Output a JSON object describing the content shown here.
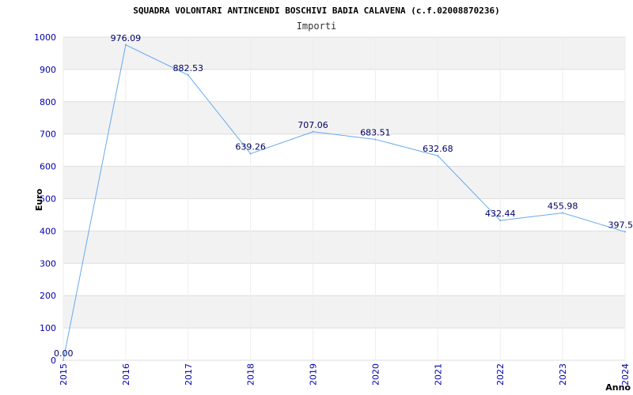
{
  "chart_data": {
    "type": "line",
    "title": "SQUADRA VOLONTARI ANTINCENDI BOSCHIVI BADIA CALAVENA (c.f.02008870236)",
    "subtitle": "Importi",
    "xlabel": "Anno",
    "ylabel": "Euro",
    "ylim": [
      0,
      1000
    ],
    "y_ticks": [
      "0",
      "100",
      "200",
      "300",
      "400",
      "500",
      "600",
      "700",
      "800",
      "900",
      "1000"
    ],
    "x": [
      "2015",
      "2016",
      "2017",
      "2018",
      "2019",
      "2020",
      "2021",
      "2022",
      "2023",
      "2024"
    ],
    "values": [
      0,
      976.09,
      882.53,
      639.26,
      707.06,
      683.51,
      632.68,
      432.44,
      455.98,
      397.5
    ],
    "data_labels": [
      "0.00",
      "976.09",
      "882.53",
      "639.26",
      "707.06",
      "683.51",
      "632.68",
      "432.44",
      "455.98",
      "397.5"
    ],
    "grid": true,
    "legend": "none",
    "colors": {
      "line": "#66aaee",
      "band": "#f2f2f2",
      "tick": "#0000aa",
      "data_label": "#000066"
    }
  }
}
